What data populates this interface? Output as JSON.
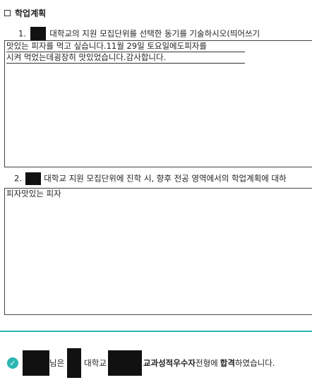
{
  "section": {
    "title": "학업계획"
  },
  "question1": {
    "number": "1.",
    "text": "대학교의 지원 모집단위를 선택한 동기를 기술하시오(띄어쓰기"
  },
  "answer1": {
    "line1": "맛있는 피자를 먹고 싶습니다.11월 29일 토요일에도피자를",
    "line2": "시켜 먹었는데굉장히 맛있었습니다.감사합니다."
  },
  "question2": {
    "number": "2.",
    "text": "대학교 지원 모집단위에 진학 시, 향후 전공 영역에서의 학업계획에 대하"
  },
  "answer2": {
    "line1": "피자맛있는 피자"
  },
  "result": {
    "part1": "님은",
    "part2": "대학교",
    "part3": "교과성적우수자",
    "part4": "전형에",
    "part5": "합격",
    "part6": "하였습니다."
  },
  "colors": {
    "accent": "#2bb6b2"
  }
}
